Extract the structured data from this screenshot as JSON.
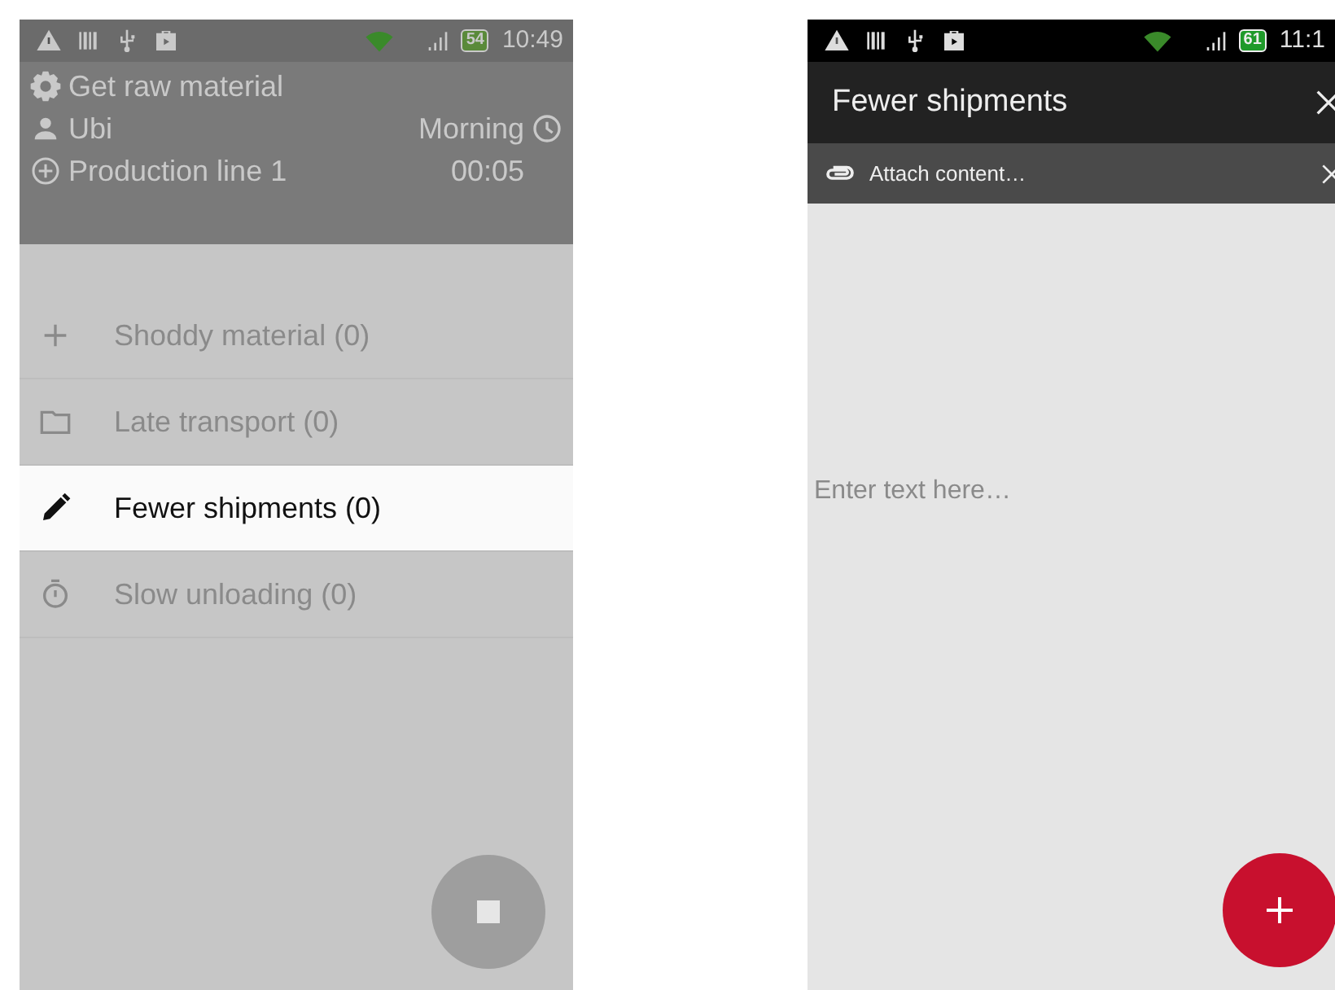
{
  "left_screen": {
    "status_bar": {
      "battery": "54",
      "time": "10:49"
    },
    "header": {
      "task": "Get raw material",
      "operator": "Ubi",
      "shift": "Morning",
      "line": "Production line 1",
      "timer": "00:05"
    },
    "categories": [
      {
        "kind": "plus",
        "label": "Shoddy material (0)",
        "selected": false
      },
      {
        "kind": "folder",
        "label": "Late transport (0)",
        "selected": false
      },
      {
        "kind": "pencil",
        "label": "Fewer shipments (0)",
        "selected": true
      },
      {
        "kind": "timer",
        "label": "Slow unloading (0)",
        "selected": false
      }
    ]
  },
  "right_screen": {
    "status_bar": {
      "battery": "61",
      "time": "11:1"
    },
    "title": "Fewer shipments",
    "attach_label": "Attach content…",
    "text_field": {
      "placeholder": "Enter text here…"
    }
  }
}
